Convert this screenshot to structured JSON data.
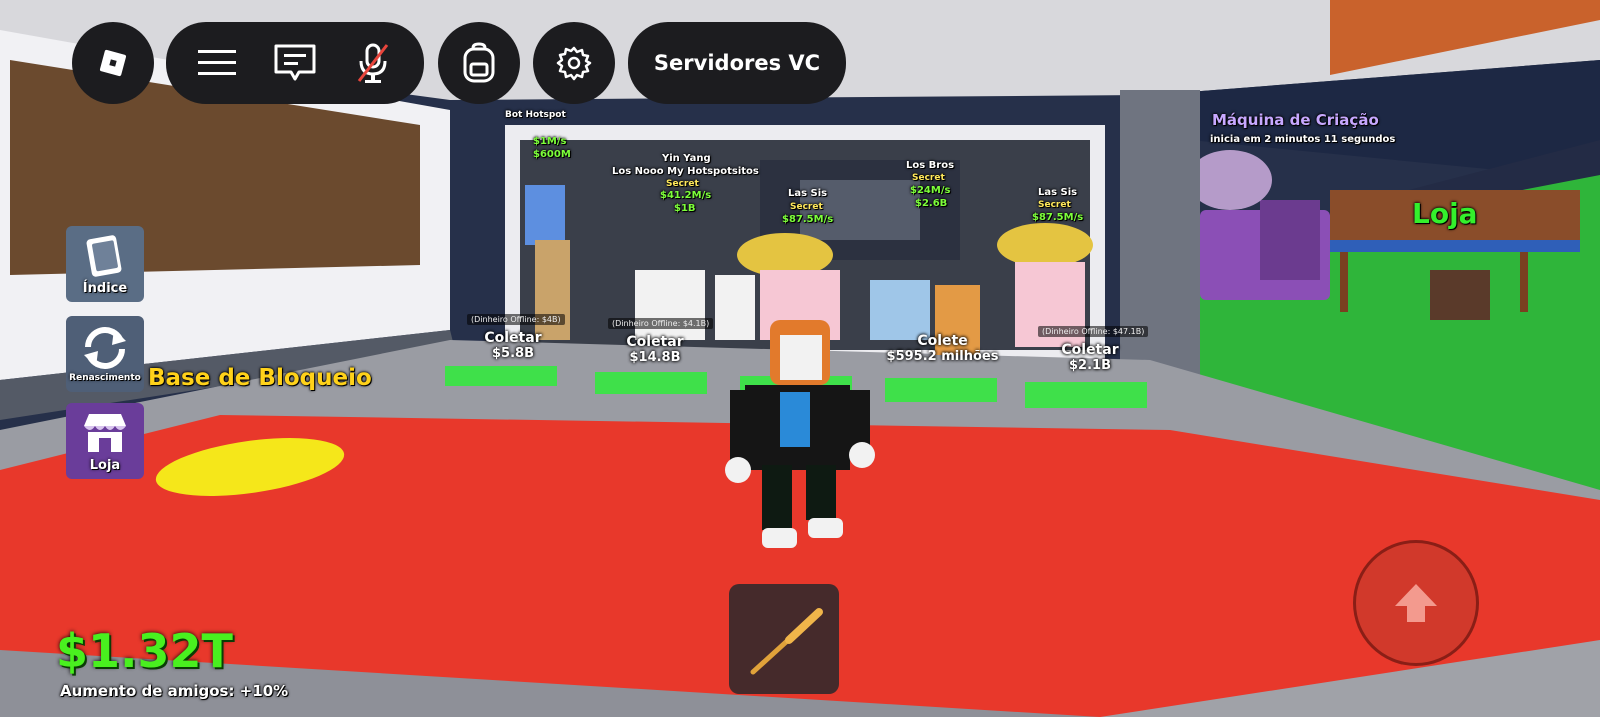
{
  "topbar": {
    "roblox_icon": "roblox-logo-icon",
    "menu_icon": "hamburger-menu-icon",
    "chat_icon": "chat-icon",
    "mic_icon": "mic-muted-icon",
    "backpack_icon": "backpack-icon",
    "settings_icon": "gear-icon",
    "servers_label": "Servidores VC"
  },
  "sidebar": {
    "items": [
      {
        "label": "Índice",
        "icon": "book-icon"
      },
      {
        "label": "Renascimento",
        "icon": "rebirth-arrows-icon"
      },
      {
        "label": "Loja",
        "icon": "store-icon"
      }
    ]
  },
  "world": {
    "base_sign": "Base de Bloqueio",
    "shop_sign": "Loja",
    "machine": {
      "title": "Máquina de Criação",
      "subtitle": "inicia em 2 minutos 11 segundos"
    },
    "hotspot": {
      "name": "Bot Hotspot",
      "rate": "$1M/s",
      "price": "$600M"
    },
    "brainrots": [
      {
        "name": "Yin Yang",
        "name2": "Los Nooo My Hotspotsitos",
        "rarity": "Secret",
        "rate": "$41.2M/s",
        "price": "$1B"
      },
      {
        "name": "Las Sis",
        "rarity": "Secret",
        "rate": "$87.5M/s",
        "price": ""
      },
      {
        "name": "Los Bros",
        "rarity": "Secret",
        "rate": "$24M/s",
        "price": "$2.6B"
      },
      {
        "name": "Las Sis",
        "rarity": "Secret",
        "rate": "$87.5M/s",
        "price": ""
      }
    ],
    "collectors": [
      {
        "label": "Coletar",
        "value": "$5.8B",
        "offline": "(Dinheiro Offline: $4B)"
      },
      {
        "label": "Coletar",
        "value": "$14.8B",
        "offline": "(Dinheiro Offline: $4.1B)"
      },
      {
        "label": "Colete",
        "value": "$595.2 milhões",
        "offline": ""
      },
      {
        "label": "Coletar",
        "value": "$2.1B",
        "offline": "(Dinheiro Offline: $47.1B)"
      }
    ]
  },
  "hud": {
    "money": "$1.32T",
    "friend_boost": "Aumento de amigos: +10%",
    "tool_icon": "baseball-bat-icon",
    "jump_icon": "jump-arrow-icon"
  },
  "colors": {
    "floor_red": "#e8382b",
    "money_green": "#49f01f",
    "pad_green": "#3fe04a",
    "hud_dark": "#1c1c1f",
    "shop_purple": "#6a3d9a"
  }
}
